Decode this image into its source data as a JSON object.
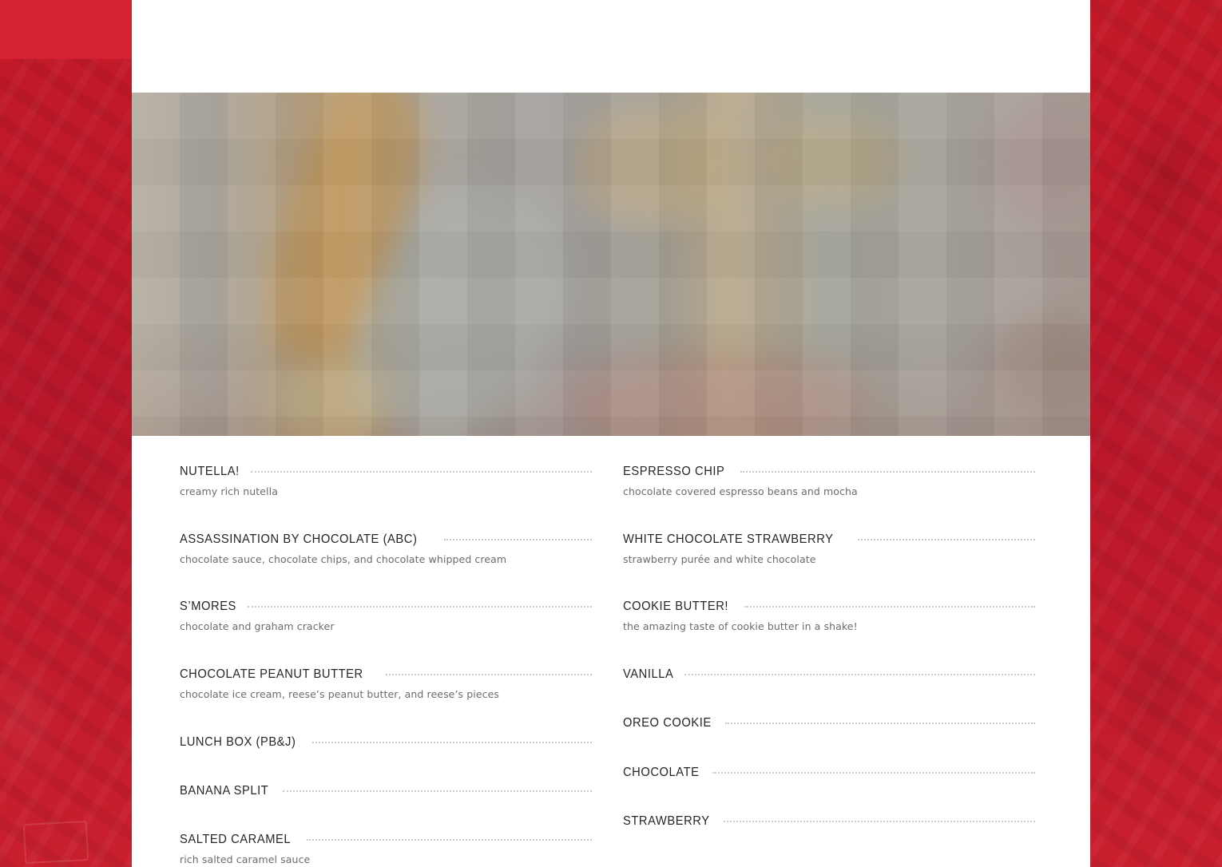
{
  "menu": {
    "left": [
      {
        "name": "NUTELLA!",
        "desc": "creamy rich nutella"
      },
      {
        "name": "ASSASSINATION BY CHOCOLATE (ABC)",
        "desc": "chocolate sauce, chocolate chips, and chocolate whipped cream"
      },
      {
        "name": "S’MORES",
        "desc": "chocolate and graham cracker"
      },
      {
        "name": "CHOCOLATE PEANUT BUTTER",
        "desc": "chocolate ice cream, reese’s peanut butter, and reese’s pieces"
      },
      {
        "name": "LUNCH BOX (PB&J)",
        "desc": ""
      },
      {
        "name": "BANANA SPLIT",
        "desc": ""
      },
      {
        "name": "SALTED CARAMEL",
        "desc": "rich salted caramel sauce"
      }
    ],
    "right": [
      {
        "name": "ESPRESSO CHIP",
        "desc": "chocolate covered espresso beans and mocha"
      },
      {
        "name": "WHITE CHOCOLATE STRAWBERRY",
        "desc": "strawberry purée and white chocolate"
      },
      {
        "name": "COOKIE BUTTER!",
        "desc": "the amazing taste of cookie butter in a shake!"
      },
      {
        "name": "VANILLA",
        "desc": ""
      },
      {
        "name": "OREO COOKIE",
        "desc": ""
      },
      {
        "name": "CHOCOLATE",
        "desc": ""
      },
      {
        "name": "STRAWBERRY",
        "desc": ""
      }
    ]
  },
  "colors": {
    "background_red": "#c61d2b",
    "page_white": "#ffffff",
    "item_name": "#262626",
    "item_desc": "#6b6b6b",
    "dot_leader": "#c9c9c9"
  }
}
